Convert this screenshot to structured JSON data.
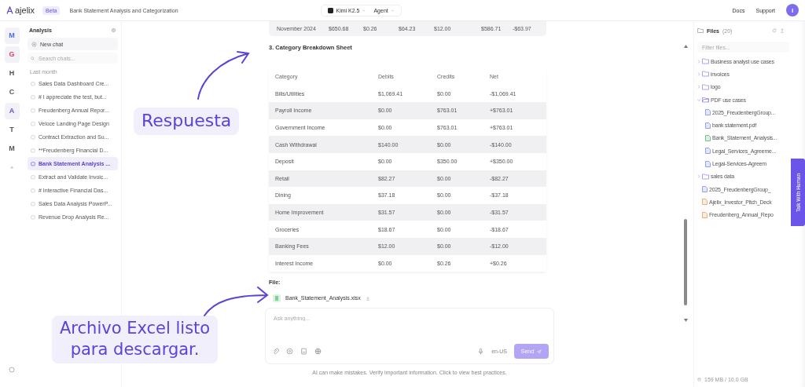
{
  "header": {
    "logo": "ajelix",
    "badge": "Beta",
    "title": "Bank Statement Analysis and Categorization",
    "model": "Kimi K2.5",
    "mode": "Agent",
    "links": [
      "Docs",
      "Support"
    ],
    "avatar": "I"
  },
  "rail": {
    "items": [
      {
        "label": "M",
        "color": "#4f6fe0"
      },
      {
        "label": "G",
        "color": "#d9455f"
      },
      {
        "label": "H"
      },
      {
        "label": "C"
      },
      {
        "label": "A",
        "color": "#6a4fe0"
      },
      {
        "label": "T"
      },
      {
        "label": "M"
      }
    ],
    "add": "+"
  },
  "sidebar": {
    "title": "Analysis",
    "new_chat": "New chat",
    "search": {
      "placeholder": "Search chats..."
    },
    "group": "Last month",
    "chats": [
      {
        "label": "Sales Data Dashboard Cre...",
        "selected": false
      },
      {
        "label": "# I appreciate the test, but...",
        "selected": false
      },
      {
        "label": "Freudenberg Annual Repor...",
        "selected": false
      },
      {
        "label": "Veloce Landing Page Design",
        "selected": false
      },
      {
        "label": "Contract Extraction and Su...",
        "selected": false
      },
      {
        "label": "**Freudenberg Financial D...",
        "selected": false
      },
      {
        "label": "Bank Statement Analysis ...",
        "selected": true
      },
      {
        "label": "Extract and Validate Invoic...",
        "selected": false
      },
      {
        "label": "# Interactive Financial Das...",
        "selected": false
      },
      {
        "label": "Sales Data Analysis PowerP...",
        "selected": false
      },
      {
        "label": "Revenue Drop Analysis Re...",
        "selected": false
      }
    ]
  },
  "main": {
    "prev_row": [
      "November 2024",
      "$650.68",
      "$0.26",
      "$64.23",
      "$12.00",
      "$586.71",
      "-$63.97"
    ],
    "heading": "3. Category Breakdown Sheet",
    "table": {
      "columns": [
        "Category",
        "Debits",
        "Credits",
        "Net"
      ],
      "rows": [
        [
          "Bills/Utilities",
          "$1,069.41",
          "$0.00",
          "-$1,069.41"
        ],
        [
          "Payroll Income",
          "$0.00",
          "$763.01",
          "+$763.01"
        ],
        [
          "Government Income",
          "$0.00",
          "$763.01",
          "+$763.01"
        ],
        [
          "Cash Withdrawal",
          "$140.00",
          "$0.00",
          "-$140.00"
        ],
        [
          "Deposit",
          "$0.00",
          "$350.00",
          "+$350.00"
        ],
        [
          "Retail",
          "$82.27",
          "$0.00",
          "-$82.27"
        ],
        [
          "Dining",
          "$37.18",
          "$0.00",
          "-$37.18"
        ],
        [
          "Home Improvement",
          "$31.57",
          "$0.00",
          "-$31.57"
        ],
        [
          "Groceries",
          "$18.67",
          "$0.00",
          "-$18.67"
        ],
        [
          "Banking Fees",
          "$12.00",
          "$0.00",
          "-$12.00"
        ],
        [
          "Interest Income",
          "$0.00",
          "$0.26",
          "+$0.26"
        ]
      ]
    },
    "file_label": "File:",
    "file": "Bank_Statement_Analysis.xlsx",
    "composer": {
      "placeholder": "Ask anything...",
      "language": "en-US",
      "send": "Send"
    },
    "disclaimer": "AI can make mistakes. Verify important information. Click to view best practices."
  },
  "files": {
    "title": "Files",
    "count": "(20)",
    "filter": {
      "placeholder": "Filter files..."
    },
    "tree": [
      {
        "kind": "folder",
        "label": "Business analyst use cases",
        "expanded": false
      },
      {
        "kind": "folder",
        "label": "invoices",
        "expanded": false
      },
      {
        "kind": "folder",
        "label": "logo",
        "expanded": false
      },
      {
        "kind": "folder",
        "label": "PDF use cases",
        "expanded": true,
        "children": [
          {
            "kind": "pdf",
            "label": "2025_FreudenbergGroup..."
          },
          {
            "kind": "pdf",
            "label": "bank statement.pdf"
          },
          {
            "kind": "sheet",
            "label": "Bank_Statement_Analysis..."
          },
          {
            "kind": "pdf",
            "label": "Legal_Services_Agreeme..."
          },
          {
            "kind": "pdf",
            "label": "Legal-Services-Agreem"
          }
        ]
      },
      {
        "kind": "folder",
        "label": "sales data",
        "expanded": false
      },
      {
        "kind": "pdf",
        "label": "2025_FreudenbergGroup_"
      },
      {
        "kind": "slides",
        "label": "Ajelix_Investor_Pitch_Deck"
      },
      {
        "kind": "slides",
        "label": "Freudenberg_Annual_Repo"
      }
    ],
    "storage": "159 MB / 10.0 GB"
  },
  "talk": "Talk With Human",
  "annotations": [
    {
      "lines": [
        "Respuesta"
      ]
    },
    {
      "lines": [
        "Archivo Excel listo",
        "para descargar."
      ]
    }
  ]
}
